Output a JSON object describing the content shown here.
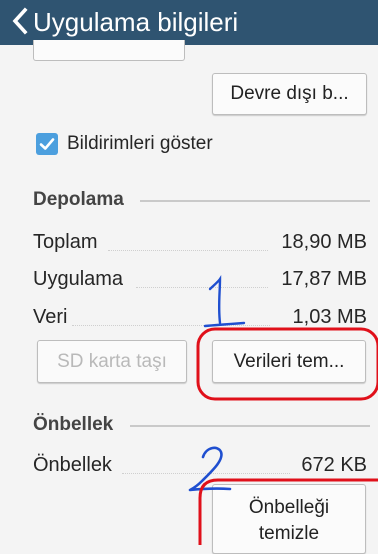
{
  "header": {
    "title": "Uygulama bilgileri",
    "background": "#2f5471",
    "back_icon": "chevron-left-icon"
  },
  "actions": {
    "disable_label": "Devre dışı b..."
  },
  "notifications": {
    "label": "Bildirimleri göster",
    "checked": true,
    "check_color": "#4c9fde"
  },
  "storage": {
    "heading": "Depolama",
    "rows": [
      {
        "label": "Toplam",
        "value": "18,90 MB"
      },
      {
        "label": "Uygulama",
        "value": "17,87 MB"
      },
      {
        "label": "Veri",
        "value": "1,03 MB"
      }
    ],
    "move_sd_label": "SD karta taşı",
    "clear_data_label": "Verileri tem..."
  },
  "cache": {
    "heading": "Önbellek",
    "row": {
      "label": "Önbellek",
      "value": "672 KB"
    },
    "clear_cache_label_line1": "Önbelleği",
    "clear_cache_label_line2": "temizle"
  },
  "annotations": {
    "marker_color": "#1f4fd0",
    "highlight_color": "#e0101a",
    "mark_1": "1",
    "mark_2": "2"
  }
}
